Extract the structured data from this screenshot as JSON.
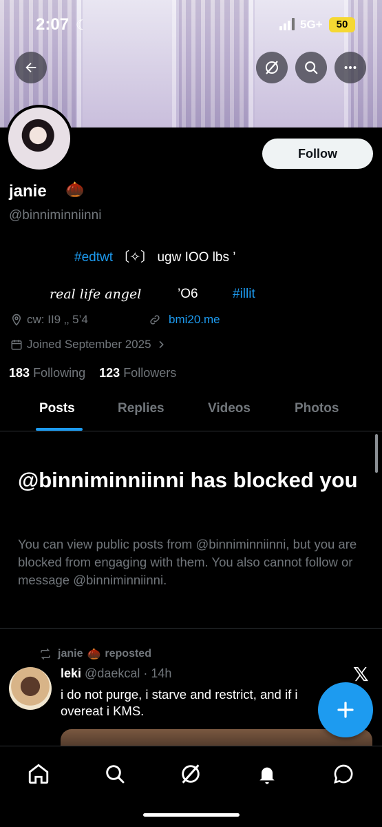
{
  "status_bar": {
    "time": "2:07",
    "network": "5G+",
    "battery": "50"
  },
  "profile": {
    "name": "janie",
    "handle": "@binniminniinni",
    "follow_label": "Follow",
    "bio_line1_tag": "#edtwt",
    "bio_line1_rest": "〔✧〕 ugw IOO lbs ’",
    "bio_line2_a": "real life angel",
    "bio_line2_b": "’O6",
    "bio_line2_c": "#illit",
    "location": "cw:  II9  ‚‚  5’4",
    "website": "bmi20.me",
    "joined": "Joined September 2025",
    "following_count": "183",
    "following_label": "Following",
    "followers_count": "123",
    "followers_label": "Followers"
  },
  "tabs": [
    {
      "label": "Posts",
      "active": true
    },
    {
      "label": "Replies",
      "active": false
    },
    {
      "label": "Videos",
      "active": false
    },
    {
      "label": "Photos",
      "active": false
    }
  ],
  "blocked": {
    "title": "@binniminniinni has blocked you",
    "body": "You can view public posts from @binniminniinni, but you are blocked from engaging with them. You also cannot follow or message @binniminniinni."
  },
  "post": {
    "repost_label": "janie",
    "repost_suffix": "reposted",
    "author_name": "leki",
    "author_handle": "@daekcal · 14h",
    "text": "i do not purge, i starve and restrict, and if i overeat i KMS.",
    "x_mark": "𝕏"
  },
  "colors": {
    "accent": "#1d9bf0",
    "secondary_text": "#71767b",
    "background": "#000000"
  },
  "icons": [
    "back-arrow-icon",
    "grok-icon",
    "search-icon",
    "more-icon",
    "location-icon",
    "link-icon",
    "calendar-icon",
    "chevron-right-icon",
    "repost-icon",
    "compose-plus-icon",
    "home-icon",
    "notification-bell-icon",
    "messages-icon"
  ]
}
